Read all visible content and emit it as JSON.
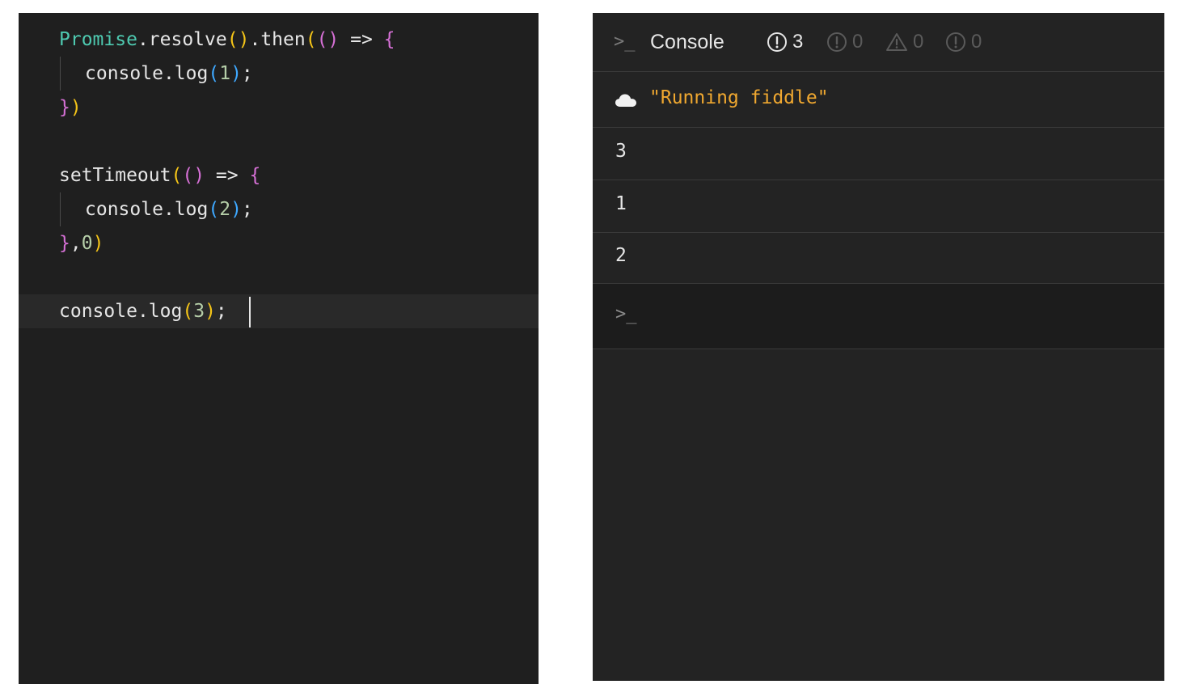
{
  "editor": {
    "lines": {
      "l1": {
        "promise": "Promise",
        "dot1": ".",
        "resolve": "resolve",
        "po1": "(",
        "pc1": ")",
        "dot2": ".",
        "then": "then",
        "po2": "(",
        "po3": "(",
        "pc3": ")",
        "arrow": " => ",
        "brace": "{"
      },
      "l2": {
        "console": "console",
        "dot": ".",
        "log": "log",
        "po": "(",
        "num": "1",
        "pc": ")",
        "semi": ";"
      },
      "l3": {
        "brace": "}",
        "pc": ")"
      },
      "l5": {
        "fn": "setTimeout",
        "po1": "(",
        "po2": "(",
        "pc2": ")",
        "arrow": " => ",
        "brace": "{"
      },
      "l6": {
        "console": "console",
        "dot": ".",
        "log": "log",
        "po": "(",
        "num": "2",
        "pc": ")",
        "semi": ";"
      },
      "l7": {
        "brace": "}",
        "comma": ",",
        "num": "0",
        "pc": ")"
      },
      "l9": {
        "console": "console",
        "dot": ".",
        "log": "log",
        "po": "(",
        "num": "3",
        "pc": ")",
        "semi": ";"
      }
    }
  },
  "console": {
    "header": {
      "prompt_icon": "terminal-icon",
      "title": "Console",
      "badges": [
        {
          "icon": "info-circle-icon",
          "count": "3"
        },
        {
          "icon": "info-circle-icon",
          "count": "0"
        },
        {
          "icon": "warning-triangle-icon",
          "count": "0"
        },
        {
          "icon": "error-circle-icon",
          "count": "0"
        }
      ]
    },
    "entries": [
      {
        "icon": "cloud-icon",
        "text": "\"Running fiddle\""
      },
      {
        "text": "3"
      },
      {
        "text": "1"
      },
      {
        "text": "2"
      }
    ],
    "input_prompt": ">_"
  },
  "colors": {
    "editor_bg": "#1f1f1f",
    "console_bg": "#232323",
    "string": "#f0a830",
    "class": "#4ec9b0",
    "bracket_yellow": "#f5c518",
    "bracket_purple": "#d670d6",
    "bracket_blue": "#3ea8ff",
    "number": "#b5cea8"
  }
}
